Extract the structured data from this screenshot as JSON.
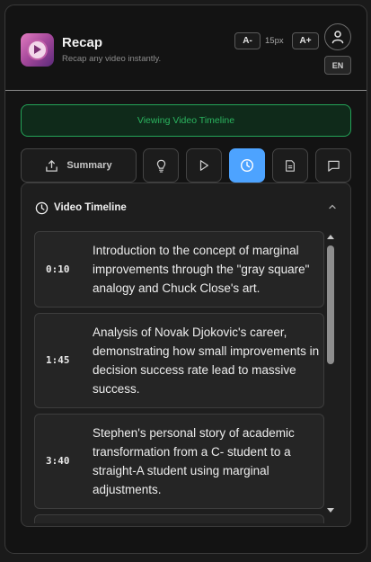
{
  "header": {
    "title": "Recap",
    "subtitle": "Recap any video instantly.",
    "font_decrease_label": "A-",
    "font_size": "15px",
    "font_increase_label": "A+",
    "language": "EN",
    "logo_icon": "play-circle-logo",
    "user_icon": "user-icon"
  },
  "status": {
    "text": "Viewing Video Timeline",
    "color": "#2bb45f"
  },
  "toolbar": {
    "summary_label": "Summary",
    "buttons": [
      {
        "name": "summary",
        "icon": "export-icon"
      },
      {
        "name": "insights",
        "icon": "lightbulb-icon"
      },
      {
        "name": "play",
        "icon": "play-icon"
      },
      {
        "name": "timeline",
        "icon": "clock-icon",
        "active": true
      },
      {
        "name": "transcript",
        "icon": "document-icon"
      },
      {
        "name": "chat",
        "icon": "chat-icon"
      }
    ],
    "active_color": "#4da3ff"
  },
  "timeline": {
    "title": "Video Timeline",
    "entries": [
      {
        "time": "0:10",
        "text": "Introduction to the concept of marginal improvements through the \"gray square\" analogy and Chuck Close's art."
      },
      {
        "time": "1:45",
        "text": "Analysis of Novak Djokovic's career, demonstrating how small improvements in decision success rate lead to massive success."
      },
      {
        "time": "3:40",
        "text": "Stephen's personal story of academic transformation from a C- student to a straight-A student using marginal adjustments."
      }
    ]
  }
}
